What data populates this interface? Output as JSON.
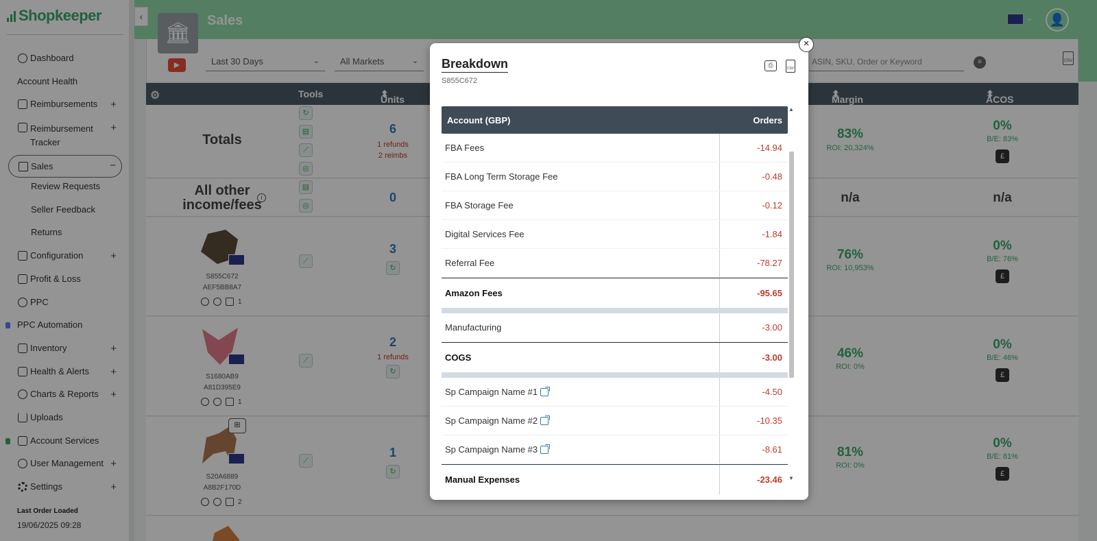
{
  "app": {
    "brand": "Shopkeeper"
  },
  "sidebar": {
    "items": [
      {
        "label": "Dashboard",
        "icon": "dashboard-icon",
        "plus": ""
      },
      {
        "label": "Account Health",
        "icon": "",
        "plus": ""
      },
      {
        "label": "Reimbursements",
        "icon": "reimbursements-icon",
        "plus": "+"
      },
      {
        "label": "Reimbursement Tracker",
        "icon": "tracker-icon",
        "plus": "+"
      },
      {
        "label": "Sales",
        "icon": "cart-icon",
        "plus": "−"
      },
      {
        "label": "Review Requests",
        "icon": "",
        "plus": ""
      },
      {
        "label": "Seller Feedback",
        "icon": "",
        "plus": ""
      },
      {
        "label": "Returns",
        "icon": "",
        "plus": ""
      },
      {
        "label": "Configuration",
        "icon": "configuration-icon",
        "plus": "+"
      },
      {
        "label": "Profit & Loss",
        "icon": "table-icon",
        "plus": ""
      },
      {
        "label": "PPC",
        "icon": "ppc-icon",
        "plus": ""
      },
      {
        "label": "PPC Automation",
        "icon": "",
        "plus": ""
      },
      {
        "label": "Inventory",
        "icon": "inventory-icon",
        "plus": "+"
      },
      {
        "label": "Health & Alerts",
        "icon": "thermometer-icon",
        "plus": "+"
      },
      {
        "label": "Charts & Reports",
        "icon": "pie-chart-icon",
        "plus": "+"
      },
      {
        "label": "Uploads",
        "icon": "upload-icon",
        "plus": ""
      },
      {
        "label": "Account Services",
        "icon": "account-services-icon",
        "plus": ""
      },
      {
        "label": "User Management",
        "icon": "users-icon",
        "plus": "+"
      },
      {
        "label": "Settings",
        "icon": "gear-icon",
        "plus": "+"
      }
    ],
    "last_order_label": "Last Order Loaded",
    "last_order_value": "19/06/2025 09:28"
  },
  "header": {
    "title": "Sales"
  },
  "filters": {
    "date_range": "Last 30 Days",
    "markets": "All Markets",
    "search_placeholder": "ASIN, SKU, Order or Keyword"
  },
  "table": {
    "columns": {
      "tools": "Tools",
      "units": "Units",
      "margin": "Margin",
      "acos": "ACOS"
    },
    "totals": {
      "title": "Totals",
      "units": "6",
      "refunds": "1 refunds",
      "reimbs": "2 reimbs",
      "margin": "83%",
      "roi": "ROI: 20,324%",
      "acos": "0%",
      "be": "B/E: 83%"
    },
    "other": {
      "title_line1": "All other",
      "title_line2": "income/fees",
      "units": "0",
      "margin": "n/a",
      "acos": "n/a"
    },
    "products": [
      {
        "sku": "S855C672",
        "asin": "AEF5BB8A7",
        "count": "1",
        "units": "3",
        "refunds": "",
        "margin": "76%",
        "roi": "ROI: 10,953%",
        "acos": "0%",
        "be": "B/E: 76%"
      },
      {
        "sku": "S1680AB9",
        "asin": "A81D395E9",
        "count": "1",
        "units": "2",
        "refunds": "1 refunds",
        "margin": "46%",
        "roi": "ROI: 0%",
        "acos": "0%",
        "be": "B/E: 46%"
      },
      {
        "sku": "S20A6889",
        "asin": "A8B2F170D",
        "count": "2",
        "units": "1",
        "refunds": "",
        "margin": "81%",
        "roi": "ROI: 0%",
        "acos": "0%",
        "be": "B/E: 81%"
      }
    ]
  },
  "modal": {
    "title": "Breakdown",
    "subtitle": "S855C672",
    "head_left": "Account (GBP)",
    "head_right": "Orders",
    "rows": [
      {
        "label": "FBA Fees",
        "value": "-14.94"
      },
      {
        "label": "FBA Long Term Storage Fee",
        "value": "-0.48"
      },
      {
        "label": "FBA Storage Fee",
        "value": "-0.12"
      },
      {
        "label": "Digital Services Fee",
        "value": "-1.84"
      },
      {
        "label": "Referral Fee",
        "value": "-78.27"
      }
    ],
    "amazon_total": {
      "label": "Amazon Fees",
      "value": "-95.65"
    },
    "cogs_rows": [
      {
        "label": "Manufacturing",
        "value": "-3.00"
      }
    ],
    "cogs_total": {
      "label": "COGS",
      "value": "-3.00"
    },
    "campaigns": [
      {
        "label": "Sp Campaign Name #1",
        "value": "-4.50"
      },
      {
        "label": "Sp Campaign Name #2",
        "value": "-10.35"
      },
      {
        "label": "Sp Campaign Name #3",
        "value": "-8.61"
      }
    ],
    "manual_total": {
      "label": "Manual Expenses",
      "value": "-23.46"
    }
  },
  "colors": {
    "accent": "#8fd9a7",
    "negative": "#c0392b",
    "header_dark": "#3f4b57"
  }
}
